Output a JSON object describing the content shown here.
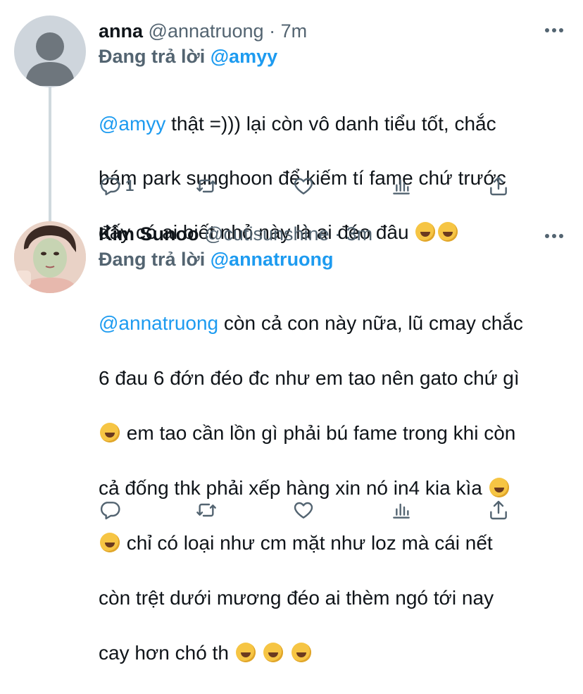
{
  "tweets": [
    {
      "name": "anna",
      "handle": "@annatruong",
      "separator": "·",
      "time": "7m",
      "reply_prefix": "Đang trả lời ",
      "reply_handle": "@amyy",
      "mention": "@amyy",
      "body_lines": [
        " thật =))) lại còn vô danh tiểu tốt, chắc",
        "bám park sunghoon để kiếm tí fame chứ trước",
        "đấy có ai biết nhỏ này là ai đéo đâu"
      ],
      "line3_emojis": [
        "rolling-on-floor-laughing",
        "rolling-on-floor-laughing"
      ],
      "reply_count": "1"
    },
    {
      "name": "Kim Sunoo",
      "handle": "@cutisunshine",
      "separator": "·",
      "time": "3m",
      "reply_prefix": "Đang trả lời ",
      "reply_handle": "@annatruong",
      "mention": "@annatruong",
      "body_line1_rest": " còn cả con này nữa, lũ cmay chắc",
      "body_line2": "6 đau 6 đớn đéo đc như em tao nên gato chứ gì",
      "body_line3": "em tao cần lồn gì phải bú fame trong khi còn",
      "body_line4": "cả đống thk phải xếp hàng xin nó in4 kia kìa",
      "body_line5": "chỉ có loại như cm mặt như loz mà cái nết",
      "body_line6": "còn trệt dưới mương đéo ai thèm ngó tới nay",
      "body_line7": "cay hơn chó th",
      "emoji_line3": "face-with-tears-of-joy",
      "emoji_line4": "rolling-on-floor-laughing",
      "emoji_line5": "rolling-on-floor-laughing",
      "emoji_line7": [
        "grinning-squinting-face",
        "grinning-squinting-face",
        "grinning-squinting-face"
      ],
      "reply_count": ""
    }
  ],
  "icons": {
    "reply": "reply-icon",
    "retweet": "retweet-icon",
    "like": "like-icon",
    "analytics": "analytics-icon",
    "share": "share-icon",
    "more": "more-icon"
  },
  "colors": {
    "accent": "#1d9bf0",
    "muted": "#536471",
    "text": "#0f1419"
  }
}
